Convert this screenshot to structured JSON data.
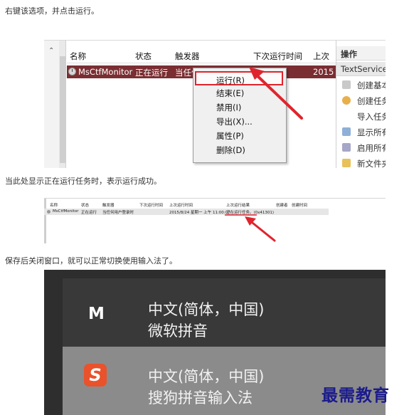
{
  "captions": {
    "step1": "右键该选项，并点击运行。",
    "step2": "当此处显示正在运行任务时，表示运行成功。",
    "step3": "保存后关闭窗口，就可以正常切换使用输入法了。"
  },
  "shot1": {
    "columns": [
      "名称",
      "状态",
      "触发器",
      "下次运行时间",
      "上次"
    ],
    "task_row": {
      "name": "MsCtfMonitor",
      "status": "正在运行",
      "trigger": "当任何用户登录时",
      "last_run": "2015"
    },
    "context_menu": [
      "运行(R)",
      "结束(E)",
      "禁用(I)",
      "导出(X)...",
      "属性(P)",
      "删除(D)"
    ],
    "actions_panel": {
      "title": "操作",
      "selected": "TextServicesF",
      "items": [
        "创建基本",
        "创建任务",
        "导入任务",
        "显示所有",
        "启用所有",
        "新文件夹"
      ]
    }
  },
  "shot2": {
    "columns": [
      "名称",
      "状态",
      "触发器",
      "下次运行时间",
      "上次运行时间",
      "上次运行结果",
      "创建者",
      "创建时间"
    ],
    "row": {
      "name": "MsCtfMonitor",
      "status": "正在运行",
      "trigger": "当任何用户登录时",
      "last_run": "2015/8/24 星期一 上午 11:00:07",
      "result": "正在运行任务。(0x41301)"
    }
  },
  "ime": [
    {
      "name": "中文(简体，中国)",
      "method": "微软拼音",
      "icon": "M"
    },
    {
      "name": "中文(简体，中国)",
      "method": "搜狗拼音输入法",
      "icon": "S"
    }
  ],
  "watermark": "最需教育",
  "colors": {
    "highlight_row": "#7a2e32",
    "callout_red": "#e0242d",
    "sogou_orange": "#e9522b"
  }
}
